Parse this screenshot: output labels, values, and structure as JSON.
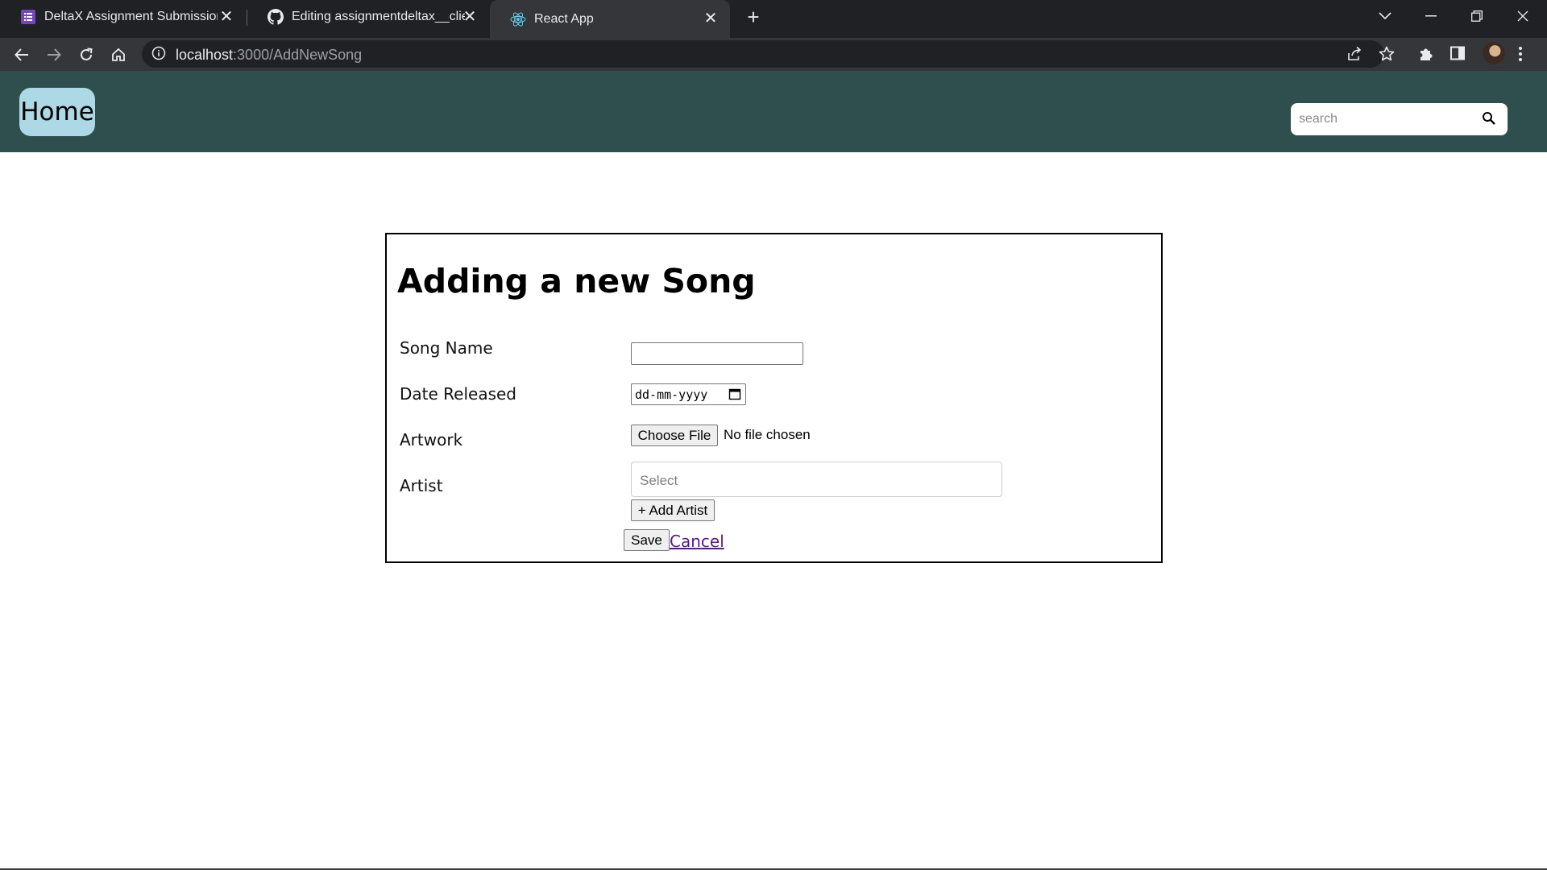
{
  "browser": {
    "tabs": [
      {
        "title": "DeltaX Assignment Submission -",
        "icon": "forms-icon"
      },
      {
        "title": "Editing assignmentdeltax__client/",
        "icon": "github-icon"
      },
      {
        "title": "React App",
        "icon": "react-icon",
        "active": true
      }
    ],
    "close_glyph": "✕",
    "new_tab_glyph": "+",
    "address": {
      "host": "localhost",
      "path": ":3000/AddNewSong"
    },
    "colors": {
      "tabstrip": "#202124",
      "toolbar": "#35363a",
      "active_tab": "#35363a"
    }
  },
  "header": {
    "home_label": "Home",
    "search_placeholder": "search",
    "background": "#2f4f4f",
    "home_background": "#add8e6"
  },
  "form": {
    "title": "Adding a new Song",
    "labels": {
      "song_name": "Song Name",
      "date_released": "Date Released",
      "artwork": "Artwork",
      "artist": "Artist"
    },
    "song_name_value": "",
    "date_placeholder": "dd-mm-yyyy",
    "file_button": "Choose File",
    "file_status": "No file chosen",
    "artist_placeholder": "Select",
    "add_artist_label": "+ Add Artist",
    "save_label": "Save",
    "cancel_label": "Cancel"
  }
}
